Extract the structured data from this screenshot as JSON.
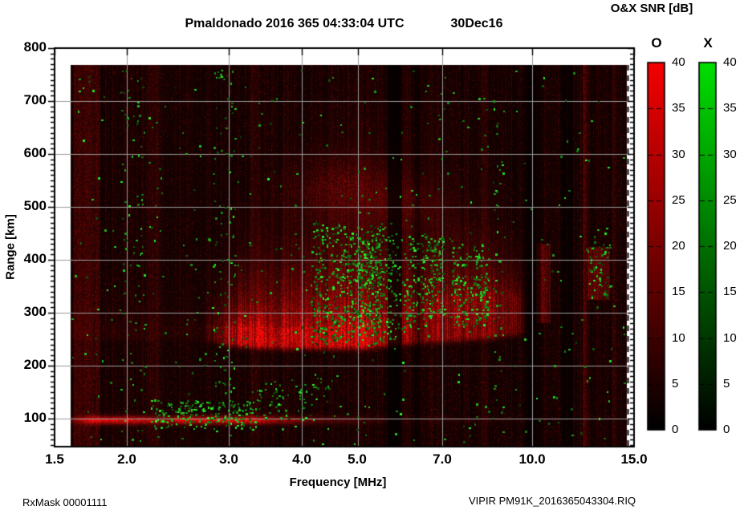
{
  "title": {
    "text": "Pmaldonado 2016 365 04:33:04 UTC",
    "date": "30Dec16"
  },
  "colorbar_title": "O&X SNR [dB]",
  "footer": {
    "left": "RxMask 00001111",
    "right": "VIPIR  PM91K_2016365043304.RIQ"
  },
  "chart_data": {
    "type": "heatmap",
    "subtype": "ionogram",
    "station": "Pmaldonado",
    "timestamp": "2016 365 04:33:04 UTC",
    "date": "30Dec16",
    "xlabel": "Frequency [MHz]",
    "ylabel": "Range [km]",
    "x_scale": "log",
    "x_range": [
      1.5,
      15
    ],
    "y_range": [
      47,
      800
    ],
    "x_ticks": [
      1.5,
      2.0,
      3.0,
      4.0,
      5.0,
      7.0,
      10.0,
      15.0
    ],
    "x_tick_labels": [
      "1.5",
      "2.0",
      "3.0",
      "4.0",
      "5.0",
      "7.0",
      "10.0",
      "15.0"
    ],
    "y_ticks": [
      100,
      200,
      300,
      400,
      500,
      600,
      700,
      800
    ],
    "y_tick_labels": [
      "100",
      "200",
      "300",
      "400",
      "500",
      "600",
      "700",
      "800"
    ],
    "grid": true,
    "grid_color": "#9c9c9c",
    "data_extent": {
      "freq_mhz": [
        1.6,
        14.57
      ],
      "range_km": [
        47,
        768
      ]
    },
    "colorbars": [
      {
        "name": "O-mode SNR",
        "label": "O",
        "units": "dB",
        "min": 0,
        "max": 40,
        "tick_step": 5,
        "color_top": "#f40000",
        "color_bottom": "#000000",
        "tick_labels": [
          "40",
          "35",
          "30",
          "25",
          "20",
          "15",
          "10",
          "5",
          "0"
        ]
      },
      {
        "name": "X-mode SNR",
        "label": "X",
        "units": "dB",
        "min": 0,
        "max": 40,
        "tick_step": 5,
        "color_top": "#00df00",
        "color_bottom": "#000000",
        "tick_labels": [
          "40",
          "35",
          "30",
          "25",
          "20",
          "15",
          "10",
          "5",
          "0"
        ]
      }
    ],
    "features": {
      "noise": {
        "base_column_amp": 0.05,
        "column_amp_var": 0.13,
        "pixel_noise_prob": 0.05,
        "pixel_noise_amp": 0.28,
        "bright_columns_mhz": [
          [
            1.62,
            1.8,
            0.2
          ],
          [
            2.18,
            2.3,
            0.08
          ],
          [
            3.27,
            3.4,
            0.1
          ],
          [
            6.6,
            6.74,
            0.08
          ],
          [
            8.18,
            8.36,
            0.08
          ],
          [
            12.22,
            12.42,
            0.22
          ],
          [
            13.72,
            13.92,
            0.15
          ]
        ]
      },
      "e_layer": {
        "center_km": 97,
        "sigma_km": 5,
        "intensity_vs_mhz": [
          [
            1.6,
            0.2
          ],
          [
            1.75,
            0.8
          ],
          [
            2.05,
            0.75
          ],
          [
            2.3,
            0.45
          ],
          [
            2.5,
            0.8
          ],
          [
            3.25,
            0.85
          ],
          [
            3.6,
            0.45
          ],
          [
            4.3,
            0.2
          ],
          [
            5.6,
            0.04
          ],
          [
            14.6,
            0
          ]
        ]
      },
      "f_layer": {
        "bottom_km_vs_mhz": [
          [
            2.7,
            256
          ],
          [
            3.0,
            245
          ],
          [
            3.6,
            240
          ],
          [
            5.2,
            240
          ],
          [
            5.8,
            246
          ],
          [
            6.6,
            251
          ],
          [
            7.6,
            255
          ],
          [
            8.6,
            259
          ],
          [
            9.6,
            267
          ]
        ],
        "intensity_vs_mhz": [
          [
            2.7,
            0.05
          ],
          [
            2.95,
            0.45
          ],
          [
            3.15,
            0.9
          ],
          [
            5.3,
            0.95
          ],
          [
            5.6,
            0.7
          ],
          [
            6.1,
            0.5
          ],
          [
            6.6,
            0.55
          ],
          [
            8.0,
            0.5
          ],
          [
            9.0,
            0.45
          ],
          [
            9.45,
            0.3
          ],
          [
            9.7,
            0.08
          ],
          [
            9.9,
            0
          ]
        ],
        "bright_thickness_km_vs_mhz": [
          [
            2.7,
            20
          ],
          [
            3.0,
            30
          ],
          [
            5.0,
            35
          ],
          [
            6.0,
            55
          ],
          [
            7.0,
            80
          ],
          [
            9.0,
            80
          ],
          [
            9.6,
            60
          ]
        ],
        "spread_decay_km_vs_mhz": [
          [
            2.7,
            40
          ],
          [
            3.5,
            70
          ],
          [
            4.5,
            105
          ],
          [
            5.5,
            115
          ],
          [
            6.5,
            95
          ],
          [
            7.5,
            80
          ],
          [
            9.0,
            60
          ],
          [
            9.6,
            40
          ]
        ]
      },
      "second_hop_blobs": [
        {
          "center_mhz": 4.8,
          "sigma_log10_mhz": 0.06,
          "center_km": 535,
          "sigma_km": 38,
          "amp": 0.26
        },
        {
          "center_mhz": 6.0,
          "sigma_log10_mhz": 0.045,
          "center_km": 505,
          "sigma_km": 30,
          "amp": 0.16
        }
      ],
      "hf_patches": [
        {
          "f_mhz": [
            10.15,
            10.75
          ],
          "range_km": [
            280,
            430
          ],
          "amp": 0.26
        },
        {
          "f_mhz": [
            12.45,
            13.65
          ],
          "range_km": [
            325,
            425
          ],
          "amp": 0.3
        }
      ],
      "rfi_gaps": [
        {
          "f_mhz": [
            5.63,
            5.97
          ],
          "attenuation": 0.8
        },
        {
          "f_mhz": [
            6.28,
            6.4
          ],
          "attenuation": 0.55
        },
        {
          "f_mhz": [
            9.72,
            10.34
          ],
          "attenuation": 0.6
        },
        {
          "f_mhz": [
            11.28,
            11.76
          ],
          "attenuation": 0.68
        }
      ],
      "x_mode_speckle_clusters": [
        {
          "f_mhz": [
            2.2,
            3.35
          ],
          "range_km": [
            82,
            135
          ],
          "count": 190
        },
        {
          "f_mhz": [
            3.35,
            3.8
          ],
          "range_km": [
            100,
            170
          ],
          "count": 45
        },
        {
          "f_mhz": [
            3.9,
            4.7
          ],
          "range_km": [
            95,
            185
          ],
          "count": 35
        },
        {
          "f_mhz": [
            4.15,
            5.7
          ],
          "range_km": [
            240,
            470
          ],
          "count": 520
        },
        {
          "f_mhz": [
            5.0,
            5.5
          ],
          "range_km": [
            270,
            440
          ],
          "count": 180
        },
        {
          "f_mhz": [
            5.7,
            6.6
          ],
          "range_km": [
            270,
            450
          ],
          "count": 150
        },
        {
          "f_mhz": [
            6.6,
            7.05
          ],
          "range_km": [
            290,
            445
          ],
          "count": 120
        },
        {
          "f_mhz": [
            7.25,
            8.45
          ],
          "range_km": [
            275,
            430
          ],
          "count": 170
        },
        {
          "f_mhz": [
            12.55,
            13.65
          ],
          "range_km": [
            330,
            430
          ],
          "count": 55
        },
        {
          "f_mhz": [
            1.95,
            2.15
          ],
          "range_km": [
            55,
            760
          ],
          "count": 70
        },
        {
          "f_mhz": [
            2.82,
            3.08
          ],
          "range_km": [
            75,
            760
          ],
          "count": 85
        },
        {
          "f_mhz": [
            8.55,
            8.95
          ],
          "range_km": [
            100,
            760
          ],
          "count": 40
        },
        {
          "f_mhz": [
            1.6,
            14.5
          ],
          "range_km": [
            50,
            760
          ],
          "count": 430
        }
      ]
    }
  }
}
